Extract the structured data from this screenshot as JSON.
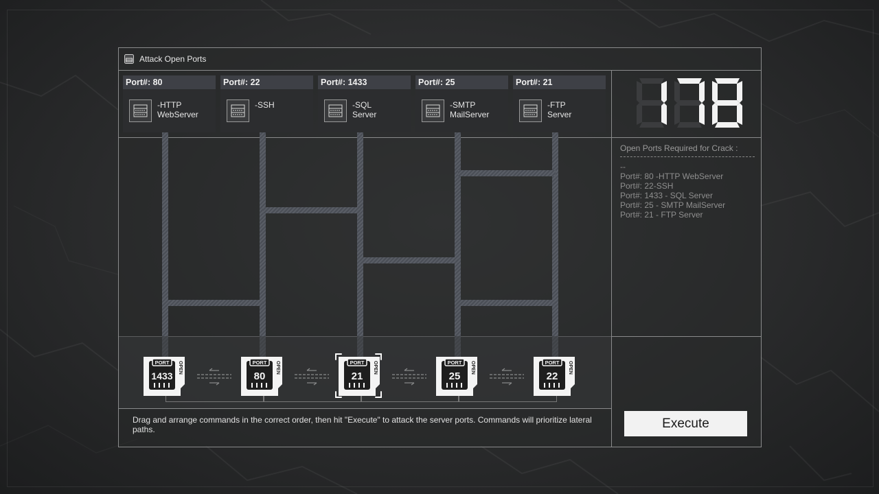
{
  "window": {
    "title": "Attack Open Ports",
    "icon": "server-icon"
  },
  "ports": [
    {
      "header": "Port#: 80",
      "desc_line1": "-HTTP",
      "desc_line2": "WebServer",
      "icon": "server-icon"
    },
    {
      "header": "Port#: 22",
      "desc_line1": "-SSH",
      "desc_line2": "",
      "icon": "server-icon"
    },
    {
      "header": "Port#: 1433",
      "desc_line1": "-SQL",
      "desc_line2": "Server",
      "icon": "server-icon"
    },
    {
      "header": "Port#: 25",
      "desc_line1": "-SMTP",
      "desc_line2": "MailServer",
      "icon": "server-icon"
    },
    {
      "header": "Port#: 21",
      "desc_line1": "-FTP",
      "desc_line2": "Server",
      "icon": "server-icon"
    }
  ],
  "score": {
    "value": "178",
    "display_digits": 3
  },
  "requirements": {
    "title": "Open Ports Required for Crack :",
    "separator": "--",
    "items": [
      "Port#: 80 -HTTP WebServer",
      "Port#: 22-SSH",
      "Port#: 1433 - SQL Server",
      "Port#: 25 - SMTP MailServer",
      "Port#: 21 - FTP Server"
    ]
  },
  "commands": [
    {
      "label": "PORT",
      "number": "1433",
      "tag": "OPEN",
      "selected": false
    },
    {
      "label": "PORT",
      "number": "80",
      "tag": "OPEN",
      "selected": false
    },
    {
      "label": "PORT",
      "number": "21",
      "tag": "OPEN",
      "selected": true
    },
    {
      "label": "PORT",
      "number": "25",
      "tag": "OPEN",
      "selected": false
    },
    {
      "label": "PORT",
      "number": "22",
      "tag": "OPEN",
      "selected": false
    }
  ],
  "instructions": "Drag and arrange commands in the correct order, then hit \"Execute\" to attack the server ports. Commands will prioritize lateral paths.",
  "execute_label": "Execute",
  "colors": {
    "bar": "#5a5e66",
    "card_header": "#3e4046",
    "card_bg": "#2c2d2f",
    "panel_border": "#8a8b8c",
    "button": "#f2f2f2"
  }
}
